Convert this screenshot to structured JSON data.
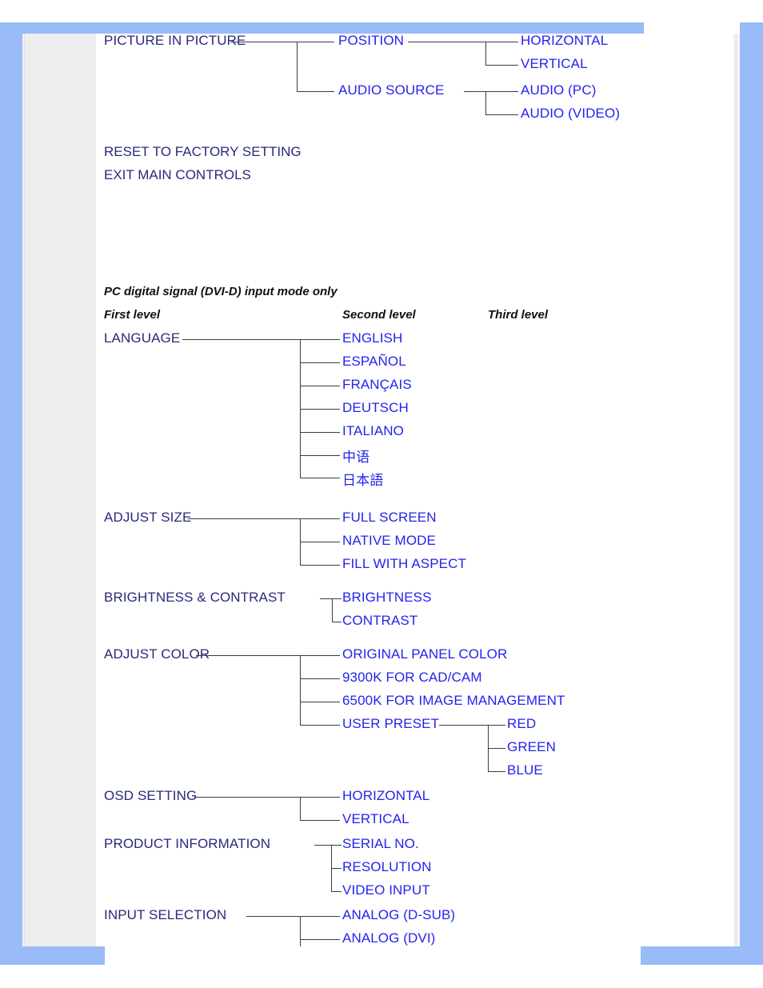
{
  "document": {
    "title": "OSD Tree - Philips Monitor On-Screen Display structure",
    "colors": {
      "level1_text": "#29297d",
      "level2_text": "#2323ee",
      "level3_text": "#2323ee",
      "frame_blue": "#99bbf7",
      "sidebar_grey": "#eeeeee",
      "connector_line": "#3c3c3c"
    }
  },
  "section_top": {
    "root": "PICTURE IN PICTURE",
    "branches": [
      {
        "label": "POSITION",
        "children": [
          "HORIZONTAL",
          "VERTICAL"
        ]
      },
      {
        "label": "AUDIO SOURCE",
        "children": [
          "AUDIO (PC)",
          "AUDIO (VIDEO)"
        ]
      }
    ],
    "standalone_items": [
      "RESET TO FACTORY SETTING",
      "EXIT MAIN CONTROLS"
    ]
  },
  "section_dvi": {
    "note": "PC digital signal (DVI-D) input mode only",
    "column_headers": {
      "first": "First level",
      "second": "Second level",
      "third": "Third level"
    },
    "groups": [
      {
        "label": "LANGUAGE",
        "children": [
          {
            "label": "ENGLISH"
          },
          {
            "label": "ESPAÑOL"
          },
          {
            "label": "FRANÇAIS"
          },
          {
            "label": "DEUTSCH"
          },
          {
            "label": "ITALIANO"
          },
          {
            "label": "中语"
          },
          {
            "label": "日本語"
          }
        ]
      },
      {
        "label": "ADJUST SIZE",
        "children": [
          {
            "label": "FULL SCREEN"
          },
          {
            "label": "NATIVE MODE"
          },
          {
            "label": "FILL WITH ASPECT"
          }
        ]
      },
      {
        "label": "BRIGHTNESS & CONTRAST",
        "children": [
          {
            "label": "BRIGHTNESS"
          },
          {
            "label": "CONTRAST"
          }
        ]
      },
      {
        "label": "ADJUST COLOR",
        "children": [
          {
            "label": "ORIGINAL PANEL COLOR"
          },
          {
            "label": "9300K FOR CAD/CAM"
          },
          {
            "label": "6500K FOR IMAGE MANAGEMENT"
          },
          {
            "label": "USER PRESET",
            "third_level": [
              "RED",
              "GREEN",
              "BLUE"
            ]
          }
        ]
      },
      {
        "label": "OSD SETTING",
        "children": [
          {
            "label": "HORIZONTAL"
          },
          {
            "label": "VERTICAL"
          }
        ]
      },
      {
        "label": "PRODUCT INFORMATION",
        "children": [
          {
            "label": "SERIAL NO."
          },
          {
            "label": "RESOLUTION"
          },
          {
            "label": "VIDEO INPUT"
          }
        ]
      },
      {
        "label": "INPUT SELECTION",
        "children": [
          {
            "label": "ANALOG (D-SUB)"
          },
          {
            "label": "ANALOG (DVI)"
          }
        ]
      }
    ]
  }
}
